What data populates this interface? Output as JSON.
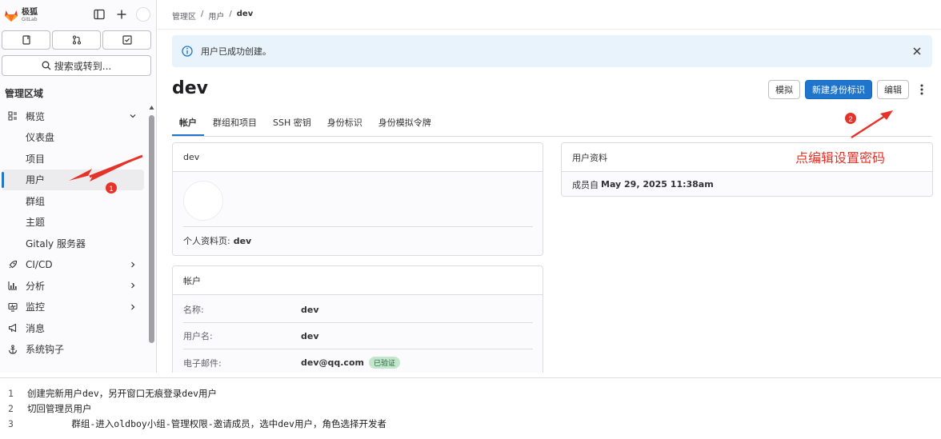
{
  "brand": {
    "name_zh": "极狐",
    "name_en": "GitLab"
  },
  "sidebar": {
    "search_label": "搜索或转到...",
    "section_title": "管理区域",
    "items": [
      {
        "label": "概览",
        "icon": "overview-icon",
        "expanded": true
      },
      {
        "label": "仪表盘"
      },
      {
        "label": "项目"
      },
      {
        "label": "用户",
        "active": true
      },
      {
        "label": "群组"
      },
      {
        "label": "主题"
      },
      {
        "label": "Gitaly 服务器"
      },
      {
        "label": "CI/CD",
        "icon": "rocket-icon"
      },
      {
        "label": "分析",
        "icon": "chart-icon"
      },
      {
        "label": "监控",
        "icon": "monitor-icon"
      },
      {
        "label": "消息",
        "icon": "megaphone-icon"
      },
      {
        "label": "系统钩子",
        "icon": "anchor-icon"
      }
    ]
  },
  "breadcrumb": [
    "管理区",
    "用户",
    "dev"
  ],
  "alert": {
    "message": "用户已成功创建。"
  },
  "page": {
    "title": "dev"
  },
  "actions": {
    "impersonate": "模拟",
    "new_identity": "新建身份标识",
    "edit": "编辑"
  },
  "tabs": [
    "帐户",
    "群组和项目",
    "SSH 密钥",
    "身份标识",
    "身份模拟令牌"
  ],
  "user_card": {
    "title": "dev",
    "profile_label": "个人资料页:",
    "profile_value": "dev"
  },
  "account_card": {
    "title": "帐户",
    "rows": [
      {
        "key": "名称:",
        "value": "dev"
      },
      {
        "key": "用户名:",
        "value": "dev"
      },
      {
        "key": "电子邮件:",
        "value": "dev@qq.com",
        "badge": "已验证"
      }
    ]
  },
  "profile_card": {
    "title": "用户资料",
    "member_since_label": "成员自",
    "member_since_value": "May 29, 2025 11:38am"
  },
  "annotation": {
    "text": "点编辑设置密码",
    "marker1": "1",
    "marker2": "2",
    "color": "#e6332a"
  },
  "notes": [
    {
      "n": "1",
      "text": "创建完新用户dev，另开窗口无痕登录dev用户"
    },
    {
      "n": "2",
      "text": "切回管理员用户"
    },
    {
      "n": "3",
      "text": "        群组-进入oldboy小组-管理权限-邀请成员，选中dev用户，角色选择开发者"
    }
  ]
}
